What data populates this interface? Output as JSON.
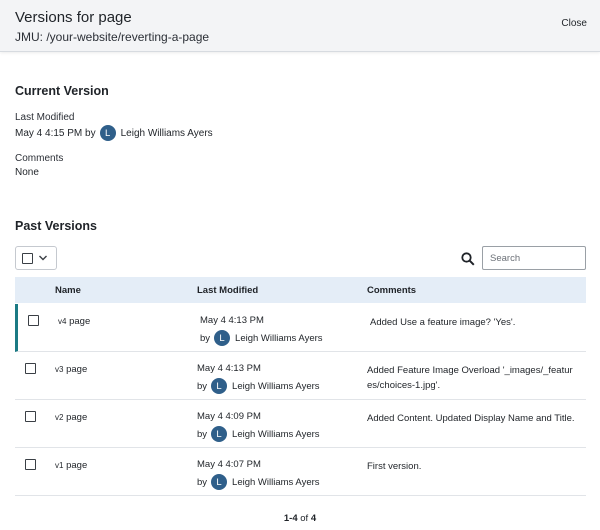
{
  "header": {
    "title": "Versions for page",
    "path": "JMU: /your-website/reverting-a-page",
    "close_label": "Close"
  },
  "current_version": {
    "heading": "Current Version",
    "last_modified_label": "Last Modified",
    "last_modified_date": "May 4 4:15 PM by",
    "user_initial": "L",
    "user_name": "Leigh Williams Ayers",
    "comments_label": "Comments",
    "comments_value": "None"
  },
  "past_versions": {
    "heading": "Past Versions",
    "search_placeholder": "Search",
    "columns": [
      "Name",
      "Last Modified",
      "Comments"
    ],
    "rows": [
      {
        "version": "v4",
        "name": "page",
        "date": "May 4 4:13 PM",
        "by": "by",
        "initial": "L",
        "user": "Leigh Williams Ayers",
        "comment": "Added Use a feature image? 'Yes'."
      },
      {
        "version": "v3",
        "name": "page",
        "date": "May 4 4:13 PM",
        "by": "by",
        "initial": "L",
        "user": "Leigh Williams Ayers",
        "comment": "Added Feature Image Overload '_images/_features/choices-1.jpg'."
      },
      {
        "version": "v2",
        "name": "page",
        "date": "May 4 4:09 PM",
        "by": "by",
        "initial": "L",
        "user": "Leigh Williams Ayers",
        "comment": "Added Content. Updated Display Name and Title."
      },
      {
        "version": "v1",
        "name": "page",
        "date": "May 4 4:07 PM",
        "by": "by",
        "initial": "L",
        "user": "Leigh Williams Ayers",
        "comment": "First version."
      }
    ],
    "pagination": {
      "range": "1-4",
      "of": "of",
      "total": "4"
    }
  },
  "colors": {
    "accent": "#1b7a84",
    "avatar": "#2f5f8a",
    "table_header": "#e4edf7"
  },
  "icons": [
    "chevron-down-icon",
    "search-icon"
  ]
}
